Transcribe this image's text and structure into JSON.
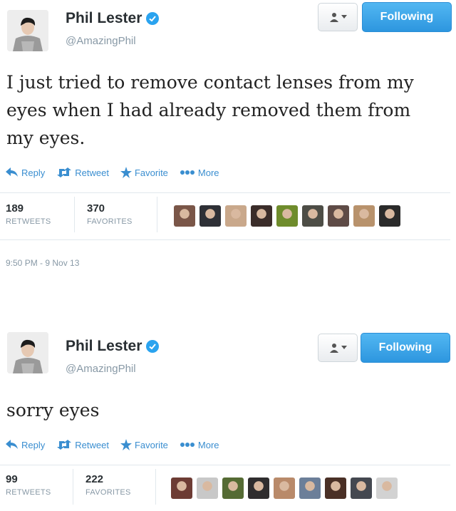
{
  "tweets": [
    {
      "author_name": "Phil Lester",
      "handle": "@AmazingPhil",
      "follow_label": "Following",
      "text": "I just tried to remove contact lenses from my eyes when I had already removed them from my eyes.",
      "actions": {
        "reply": "Reply",
        "retweet": "Retweet",
        "favorite": "Favorite",
        "more": "More"
      },
      "retweets_count": "189",
      "retweets_label": "RETWEETS",
      "favorites_count": "370",
      "favorites_label": "FAVORITES",
      "timestamp": "9:50 PM - 9 Nov 13",
      "face_colors": [
        "#7a5648",
        "#2e3036",
        "#c9a88b",
        "#3b2d2a",
        "#6f8c2c",
        "#4d4d46",
        "#5e4b46",
        "#b8926c",
        "#2a2a2a"
      ]
    },
    {
      "author_name": "Phil Lester",
      "handle": "@AmazingPhil",
      "follow_label": "Following",
      "text": "sorry eyes",
      "actions": {
        "reply": "Reply",
        "retweet": "Retweet",
        "favorite": "Favorite",
        "more": "More"
      },
      "retweets_count": "99",
      "retweets_label": "RETWEETS",
      "favorites_count": "222",
      "favorites_label": "FAVORITES",
      "face_colors": [
        "#6d3c34",
        "#c8c8c8",
        "#556b34",
        "#2f2d2e",
        "#b98a6a",
        "#6c7f99",
        "#4a3026",
        "#444850",
        "#d2d2d2"
      ]
    }
  ],
  "colors": {
    "accent": "#2aa3ef",
    "link": "#3a8ed0",
    "muted": "#8899a6",
    "text": "#292f33"
  }
}
